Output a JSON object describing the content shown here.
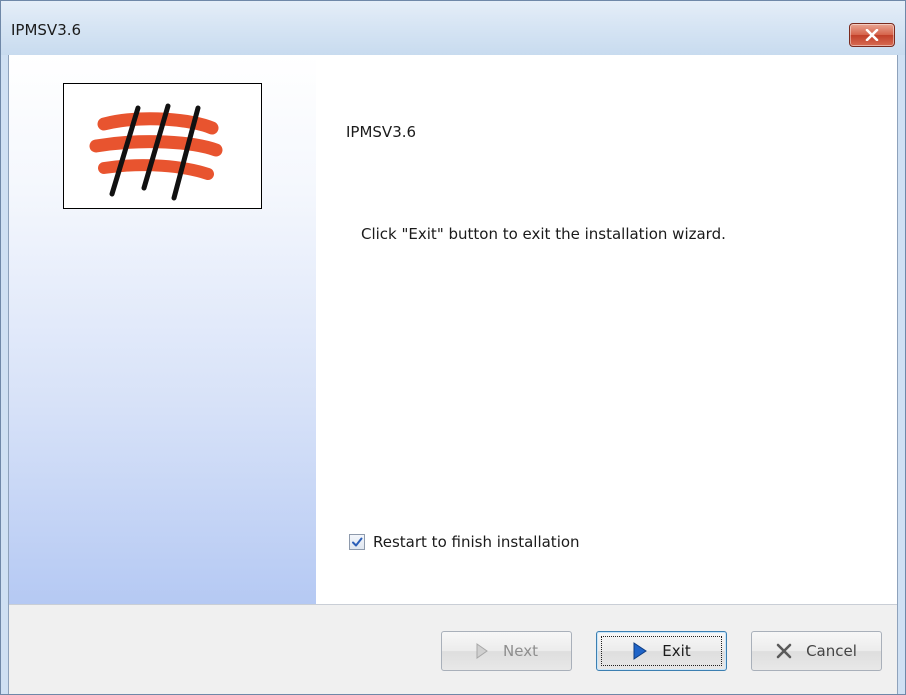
{
  "window": {
    "title": "IPMSV3.6"
  },
  "content": {
    "product_name": "IPMSV3.6",
    "message": "Click \"Exit\" button to exit the installation wizard."
  },
  "restart_option": {
    "label": "Restart to finish installation",
    "checked": true
  },
  "buttons": {
    "next": "Next",
    "exit": "Exit",
    "cancel": "Cancel"
  },
  "colors": {
    "logo_stroke": "#e8542f",
    "checkmark": "#2c5fb8",
    "exit_arrow": "#1f64c8"
  },
  "icons": {
    "close": "close-icon",
    "next": "arrow-right-icon",
    "exit": "arrow-right-icon",
    "cancel": "x-icon",
    "logo": "app-logo"
  }
}
